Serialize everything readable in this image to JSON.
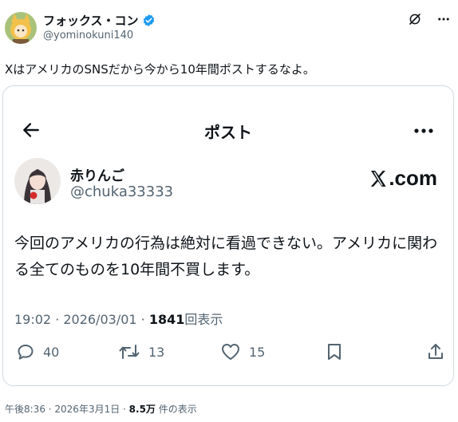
{
  "post": {
    "display_name": "フォックス・コン",
    "handle": "@yominokuni140",
    "text": "XはアメリカのSNSだから今から10年間ポストするなよ。",
    "footer": {
      "time": "午後8:36",
      "sep1": " · ",
      "date": "2026年3月1日",
      "sep2": " · ",
      "views": "8.5万",
      "views_label": " 件の表示"
    }
  },
  "embedded": {
    "header_title": "ポスト",
    "display_name": "赤りんご",
    "handle": "@chuka33333",
    "brand": ".com",
    "text": "今回のアメリカの行為は絶対に看過できない。アメリカに関わる全てのものを10年間不買します。",
    "meta": {
      "time_date": "19:02 · 2026/03/01 · ",
      "views": "1841",
      "views_label": "回表示"
    },
    "actions": {
      "reply_count": "40",
      "repost_count": "13",
      "like_count": "15"
    }
  },
  "colors": {
    "text_primary": "#0f1419",
    "text_secondary": "#536471",
    "verified": "#1d9bf0",
    "border": "#cfd9de"
  }
}
